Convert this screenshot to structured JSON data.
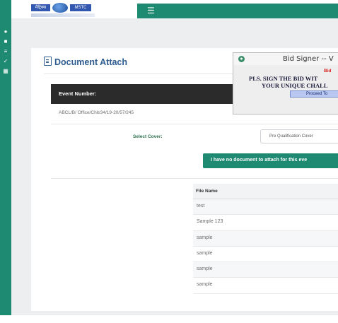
{
  "header": {
    "logo_left": "मैट्रिक्स",
    "logo_right": "MSTC",
    "menu_icon": "hamburger-icon"
  },
  "sidebar": {
    "icons": [
      "user-icon",
      "user-icon",
      "list-icon",
      "check-icon",
      "grid-icon"
    ]
  },
  "page": {
    "title": "Document Attach",
    "title_icon": "document-icon"
  },
  "event": {
    "label": "Event Number:",
    "value": "ABCL/B/ Office/Chit/34/19-20/57/245"
  },
  "cover": {
    "label": "Select Cover:",
    "selected": "Pre Qualification Cover"
  },
  "no_document_button": "I have no document to attach for this eve",
  "files_table": {
    "header": "File Name",
    "rows": [
      "test",
      "Sample 123",
      "sample",
      "sample",
      "sample",
      "sample"
    ]
  },
  "bid_signer": {
    "title": "Bid Signer -- V",
    "red_text": "Bid",
    "line1": "PLS. SIGN THE BID WIT",
    "line2": "YOUR UNIQUE CHALL",
    "proceed_label": "Proceed To"
  },
  "colors": {
    "brand_green": "#1f8a72",
    "title_blue": "#2d5c91",
    "event_bar": "#2b2b2b"
  }
}
